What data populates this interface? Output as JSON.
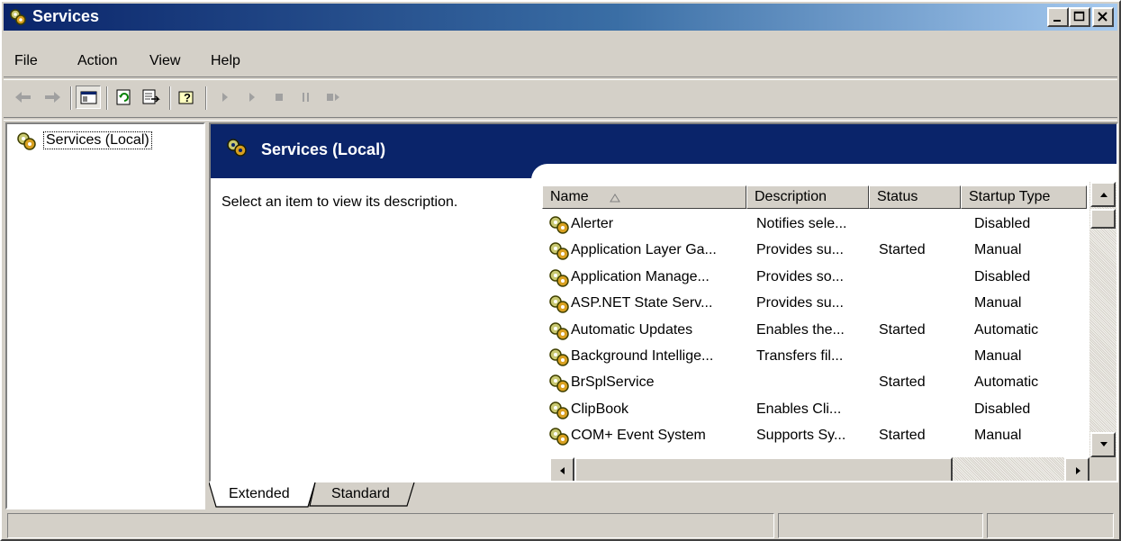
{
  "window": {
    "title": "Services",
    "icon": "gears-icon",
    "controls": [
      "minimize-icon",
      "maximize-icon",
      "close-icon"
    ]
  },
  "menu": [
    "File",
    "Action",
    "View",
    "Help"
  ],
  "toolbar": [
    "back-arrow-icon",
    "forward-arrow-icon",
    "show-hide-console-tree-icon",
    "refresh-icon",
    "export-list-icon",
    "help-icon",
    "start-service-icon",
    "start-service-icon",
    "stop-service-icon",
    "pause-service-icon",
    "restart-service-icon"
  ],
  "tree": {
    "root_label": "Services (Local)"
  },
  "panel": {
    "title": "Services (Local)",
    "description_prompt": "Select an item to view its description."
  },
  "list": {
    "columns": [
      "Name",
      "Description",
      "Status",
      "Startup Type"
    ],
    "rows": [
      {
        "name": "Alerter",
        "description": "Notifies sele...",
        "status": "",
        "startup": "Disabled"
      },
      {
        "name": "Application Layer Ga...",
        "description": "Provides su...",
        "status": "Started",
        "startup": "Manual"
      },
      {
        "name": "Application Manage...",
        "description": "Provides so...",
        "status": "",
        "startup": "Disabled"
      },
      {
        "name": "ASP.NET State Serv...",
        "description": "Provides su...",
        "status": "",
        "startup": "Manual"
      },
      {
        "name": "Automatic Updates",
        "description": "Enables the...",
        "status": "Started",
        "startup": "Automatic"
      },
      {
        "name": "Background Intellige...",
        "description": "Transfers fil...",
        "status": "",
        "startup": "Manual"
      },
      {
        "name": "BrSplService",
        "description": "",
        "status": "Started",
        "startup": "Automatic"
      },
      {
        "name": "ClipBook",
        "description": "Enables Cli...",
        "status": "",
        "startup": "Disabled"
      },
      {
        "name": "COM+ Event System",
        "description": "Supports Sy...",
        "status": "Started",
        "startup": "Manual"
      }
    ]
  },
  "tabs": [
    "Extended",
    "Standard"
  ],
  "colors": {
    "title_active": "#0a246a",
    "face": "#d4d0c8"
  }
}
